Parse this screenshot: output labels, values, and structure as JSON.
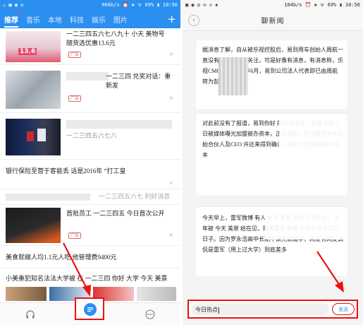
{
  "left": {
    "status": {
      "left_icons": "⚠ ▣ ◉ ◎",
      "right": "966b/s ⏰ ❖ ᯤ 69% ▮ 10:56"
    },
    "tabs": [
      {
        "label": "推荐",
        "active": true
      },
      {
        "label": "音乐",
        "active": false
      },
      {
        "label": "本地",
        "active": false
      },
      {
        "label": "科技",
        "active": false
      },
      {
        "label": "娱乐",
        "active": false
      },
      {
        "label": "图片",
        "active": false
      }
    ],
    "add_label": "+",
    "feed": [
      {
        "title": "一二三四五六七八九十 小天 美物号 随货选优惠13.6元",
        "badge": "广告",
        "thumb_text": "13.6"
      },
      {
        "title": "一二三四 兑奖对话：重新发",
        "badge": "广告"
      },
      {
        "title": "一二三四五六七八",
        "badge": ""
      },
      {
        "title": "银行保险至营于客能丢 话是2016年 “打工皇",
        "badge": ""
      },
      {
        "title": "一二三四五六七 利好消息",
        "badge": ""
      },
      {
        "title": "首批员工 一二三四五 今日首次公开",
        "badge": "广告"
      },
      {
        "title": "美食就碳人均1.1元人吃 他管理费9400元",
        "badge": ""
      },
      {
        "title": "小美重犯知名法法大学被 在 一二三四 你好 大学 今天 美景 美",
        "badge": ""
      }
    ],
    "nav": {
      "headphone": "headphone-icon",
      "chat": "chat-bubble-icon",
      "more": "more-icon"
    }
  },
  "right": {
    "status": {
      "left_icons": "▣ ◉ ◎ ✉ ◇ ◈",
      "right": "104b/s ⏰ ❖ ᯤ 69% ▮ 10:56"
    },
    "back_label": "‹",
    "title": "聊新闻",
    "messages": [
      "据消息了解，自从被乐视控股后，易到用车创始人周航一直没有消息，各受关注，可是好像有消息，有消息称，乐视CMO 有人在去年6月，易到公司法人代表即已由周航转为彭钢。",
      "对此前没有了报道，易到你好 的后续消息，易到 创始人 日被媒体曝光加盟被办资本，正式离职，经过被办资本创始合伙人及CEO 许达来得到确认，周航已经加盟被办资本",
      "今天早上，雷军微博 有人 大学 美景 支持 交流华生，当年被 今天 美景 给在见，随即雷军 新闻 武汉大学上学的日子。因为罗永浩高中长期不读完就辍学，网友有网友调侃是雷军（用上过大学）到底差多"
    ],
    "input_value": "今日热点",
    "send_label": "发送"
  }
}
